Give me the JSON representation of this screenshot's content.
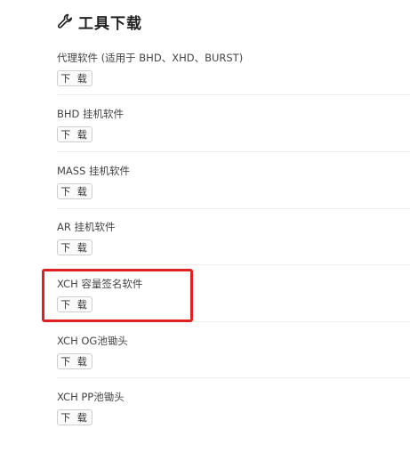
{
  "header": {
    "icon": "wrench-icon",
    "title": "工具下载"
  },
  "items": [
    {
      "label": "代理软件 (适用于 BHD、XHD、BURST)",
      "button": "下 载"
    },
    {
      "label": "BHD 挂机软件",
      "button": "下 载"
    },
    {
      "label": "MASS 挂机软件",
      "button": "下 载"
    },
    {
      "label": "AR 挂机软件",
      "button": "下 载"
    },
    {
      "label": "XCH 容量签名软件",
      "button": "下 载"
    },
    {
      "label": "XCH OG池锄头",
      "button": "下 载"
    },
    {
      "label": "XCH PP池锄头",
      "button": "下 载"
    }
  ],
  "colors": {
    "highlight": "#e0201f",
    "divider": "#ececec",
    "text": "#444444"
  }
}
